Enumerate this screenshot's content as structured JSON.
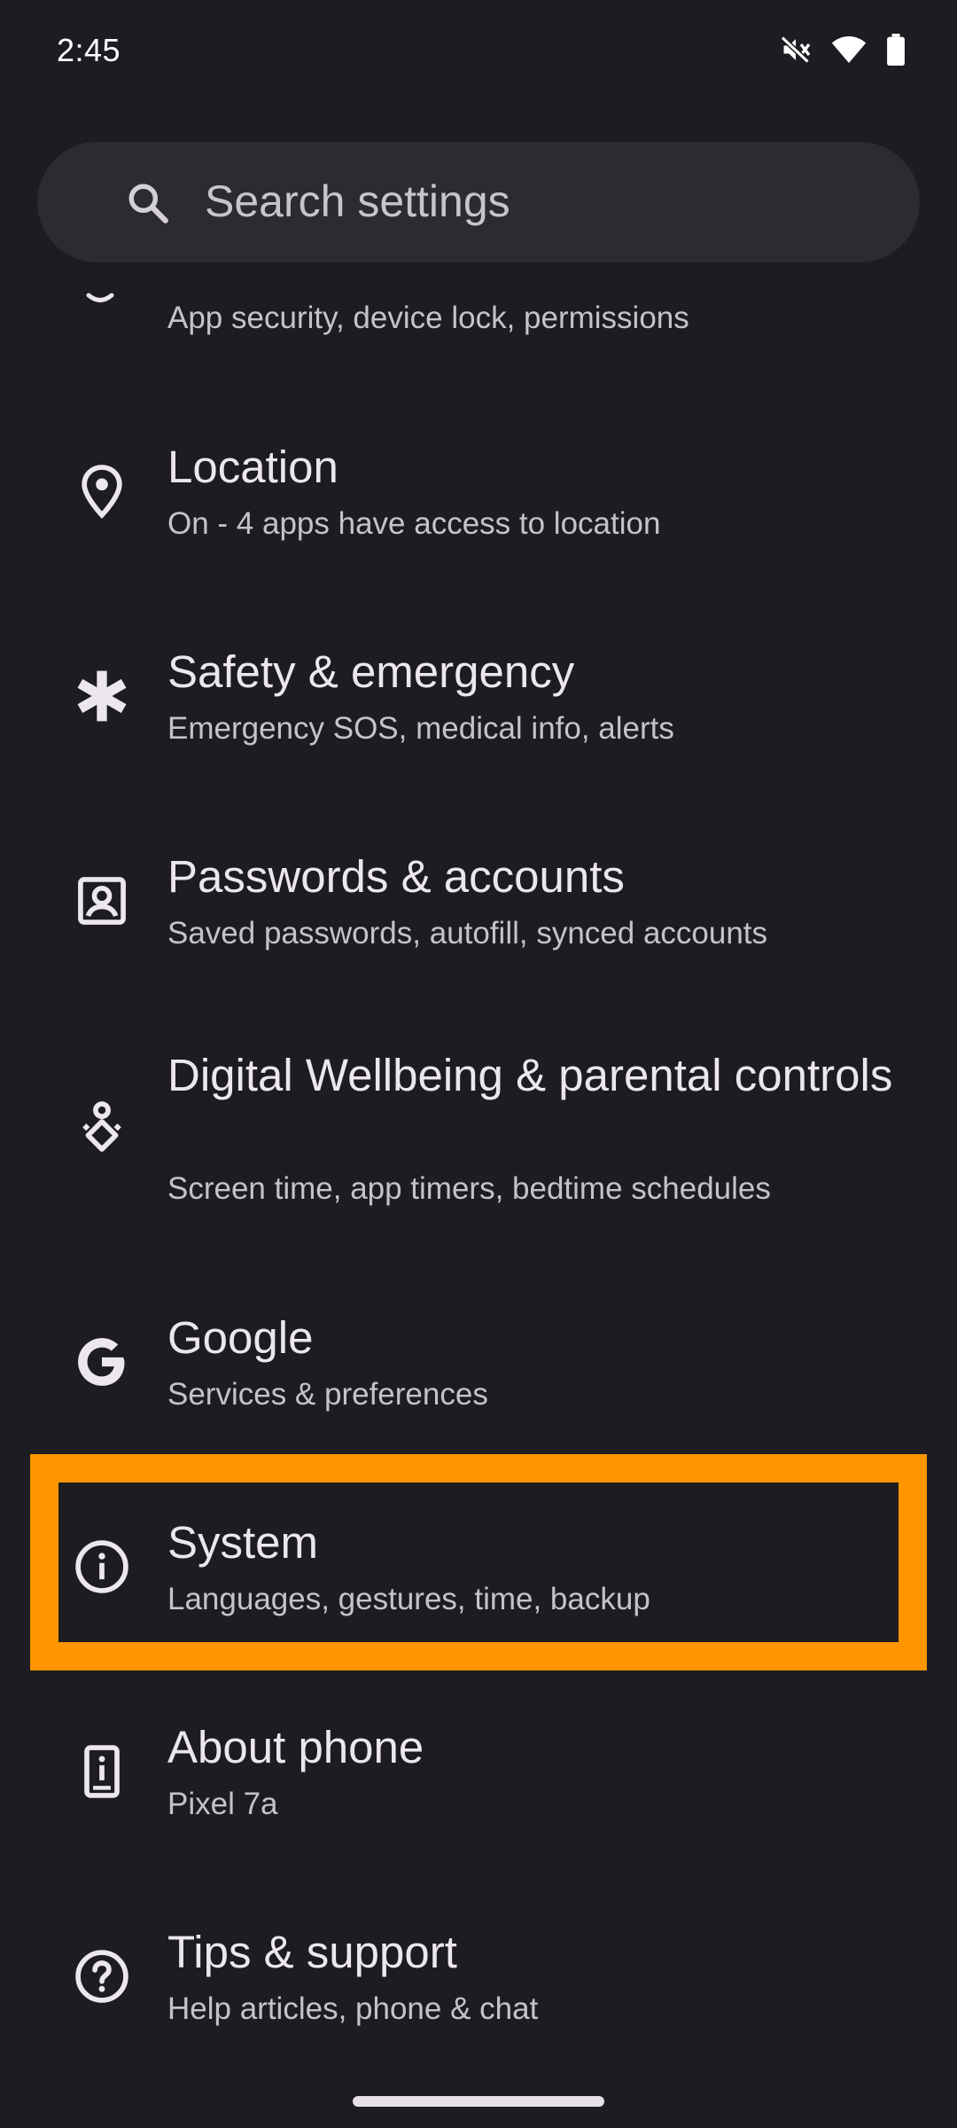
{
  "status_bar": {
    "time": "2:45",
    "icons": [
      "mute-icon",
      "wifi-icon",
      "battery-icon"
    ]
  },
  "search": {
    "placeholder": "Search settings"
  },
  "items": [
    {
      "id": "security",
      "title": "",
      "subtitle": "App security, device lock, permissions",
      "icon": "security-icon"
    },
    {
      "id": "location",
      "title": "Location",
      "subtitle": "On - 4 apps have access to location",
      "icon": "location-pin-icon"
    },
    {
      "id": "safety",
      "title": "Safety & emergency",
      "subtitle": "Emergency SOS, medical info, alerts",
      "icon": "asterisk-icon"
    },
    {
      "id": "passwords",
      "title": "Passwords & accounts",
      "subtitle": "Saved passwords, autofill, synced accounts",
      "icon": "account-box-icon"
    },
    {
      "id": "wellbeing",
      "title": "Digital Wellbeing & parental controls",
      "subtitle": "Screen time, app timers, bedtime schedules",
      "icon": "wellbeing-icon"
    },
    {
      "id": "google",
      "title": "Google",
      "subtitle": "Services & preferences",
      "icon": "google-g-icon"
    },
    {
      "id": "system",
      "title": "System",
      "subtitle": "Languages, gestures, time, backup",
      "icon": "info-icon"
    },
    {
      "id": "about",
      "title": "About phone",
      "subtitle": "Pixel 7a",
      "icon": "phone-info-icon"
    },
    {
      "id": "tips",
      "title": "Tips & support",
      "subtitle": "Help articles, phone & chat",
      "icon": "help-circle-icon"
    }
  ],
  "colors": {
    "background": "#1d1c22",
    "search_bg": "#2c2b31",
    "highlight": "#ff9500"
  }
}
